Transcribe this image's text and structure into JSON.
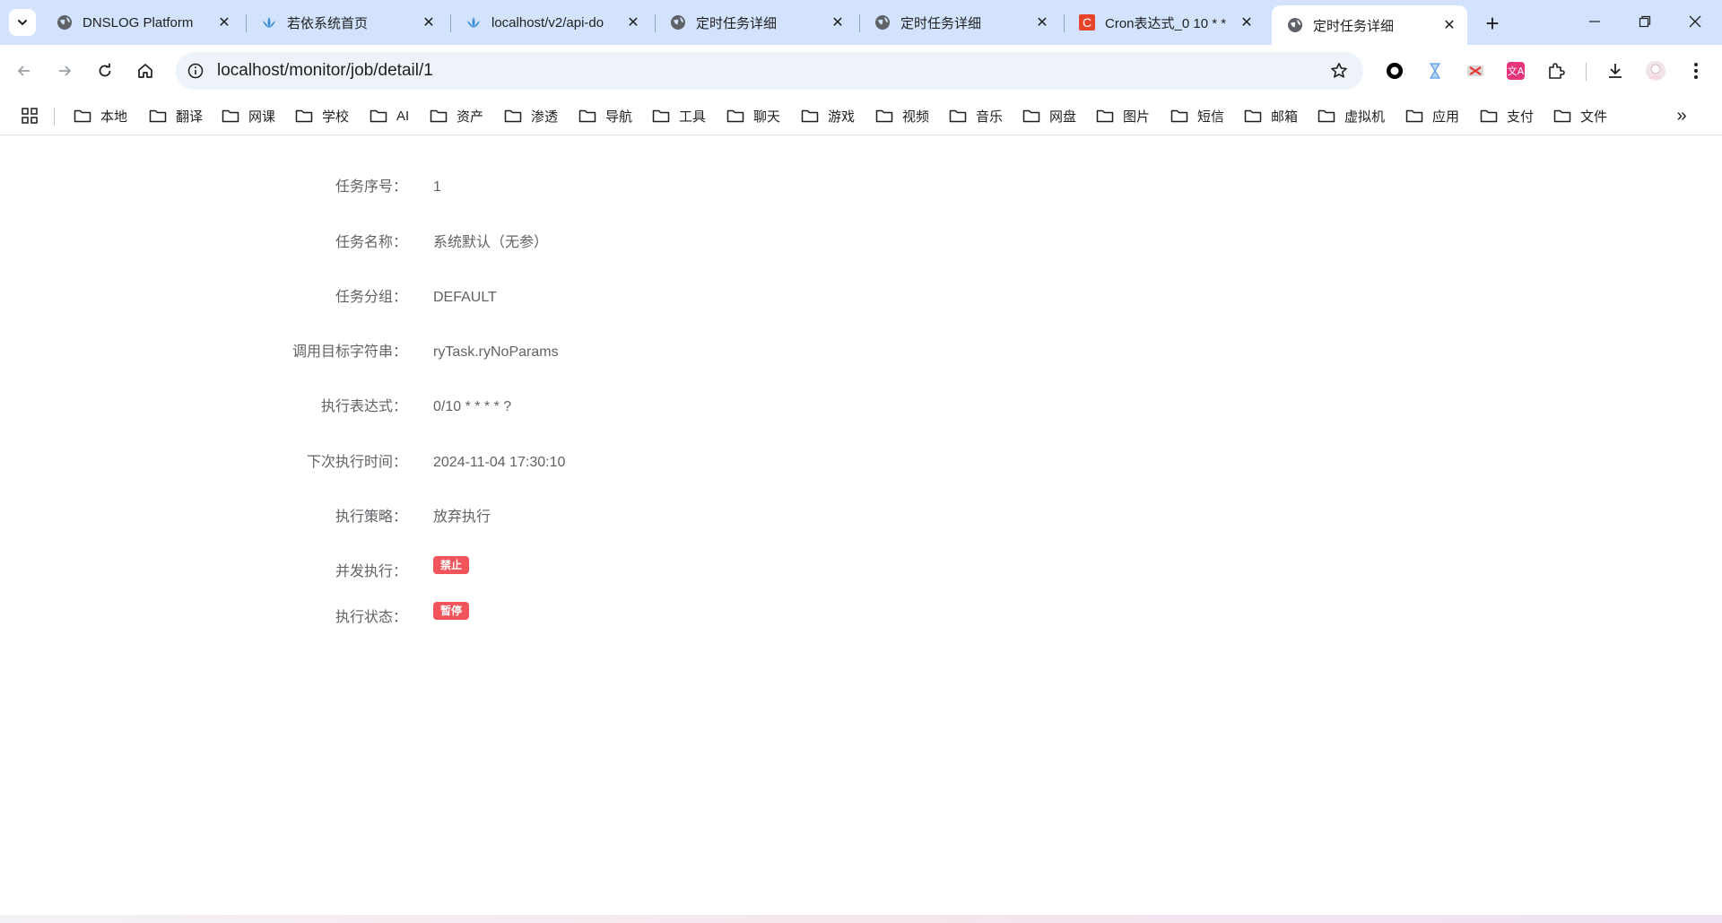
{
  "tabs": [
    {
      "title": "DNSLOG Platform",
      "favicon": "globe-icon",
      "active": false
    },
    {
      "title": "若依系统首页",
      "favicon": "ruoyi-icon",
      "active": false
    },
    {
      "title": "localhost/v2/api-do",
      "favicon": "ruoyi-icon",
      "active": false
    },
    {
      "title": "定时任务详细",
      "favicon": "globe-icon",
      "active": false
    },
    {
      "title": "定时任务详细",
      "favicon": "globe-icon",
      "active": false
    },
    {
      "title": "Cron表达式_0 10 * *",
      "favicon": "cron-c-icon",
      "active": false
    },
    {
      "title": "定时任务详细",
      "favicon": "globe-icon",
      "active": true
    }
  ],
  "address": {
    "url": "localhost/monitor/job/detail/1"
  },
  "bookmarks": [
    "本地",
    "翻译",
    "网课",
    "学校",
    "AI",
    "资产",
    "渗透",
    "导航",
    "工具",
    "聊天",
    "游戏",
    "视频",
    "音乐",
    "网盘",
    "图片",
    "短信",
    "邮箱",
    "虚拟机",
    "应用",
    "支付",
    "文件"
  ],
  "detail": {
    "job_id": {
      "label": "任务序号：",
      "value": "1"
    },
    "job_name": {
      "label": "任务名称：",
      "value": "系统默认（无参）"
    },
    "job_group": {
      "label": "任务分组：",
      "value": "DEFAULT"
    },
    "invoke_target": {
      "label": "调用目标字符串：",
      "value": "ryTask.ryNoParams"
    },
    "cron": {
      "label": "执行表达式：",
      "value": "0/10 * * * * ?"
    },
    "next_time": {
      "label": "下次执行时间：",
      "value": "2024-11-04 17:30:10"
    },
    "misfire": {
      "label": "执行策略：",
      "value": "放弃执行"
    },
    "concurrent": {
      "label": "并发执行：",
      "value": "禁止"
    },
    "status": {
      "label": "执行状态：",
      "value": "暂停"
    }
  },
  "colors": {
    "tabstrip_bg": "#d3e3fd",
    "omnibox_bg": "#eef2f9",
    "tag_danger": "#f2545b",
    "label_text": "#606266",
    "arrow": "#e8322b"
  }
}
